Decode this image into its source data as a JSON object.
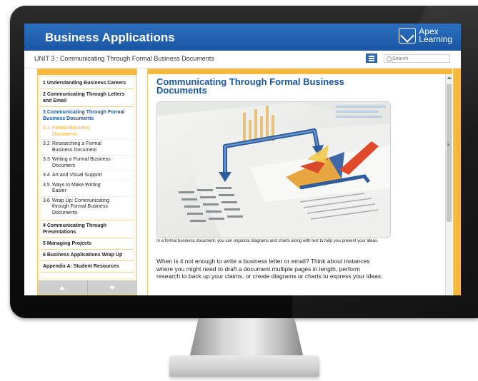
{
  "app": {
    "title": "Business Applications",
    "logo_line1": "Apex",
    "logo_line2": "Learning"
  },
  "breadcrumb": "UNIT 3 : Communicating Through Formal Business Documents",
  "search": {
    "placeholder": "Search"
  },
  "sidebar": {
    "units": [
      {
        "label": "1  Understanding Business Careers"
      },
      {
        "label": "2  Communicating Through Letters and Email"
      },
      {
        "label": "3  Communicating Through Formal Business Documents"
      }
    ],
    "lessons": [
      {
        "num": "3.1",
        "label": "Formal Business Documents"
      },
      {
        "num": "3.2",
        "label": "Researching a Formal Business Document"
      },
      {
        "num": "3.3",
        "label": "Writing a Formal Business Document"
      },
      {
        "num": "3.4",
        "label": "Art and Visual Support"
      },
      {
        "num": "3.5",
        "label": "Ways to Make Writing Easier"
      },
      {
        "num": "3.6",
        "label": "Wrap Up: Communicating through Formal Business Documents"
      }
    ],
    "units_after": [
      {
        "label": "4  Communicating Through Presentations"
      },
      {
        "label": "5  Managing Projects"
      },
      {
        "label": "6  Business Applications Wrap Up"
      },
      {
        "label": "Appendix A: Student Resources"
      }
    ]
  },
  "content": {
    "title": "Communicating Through Formal Business Documents",
    "caption": "In a formal business document, you can organize diagrams and charts along with text to help you present your ideas.",
    "body": "When is it not enough to write a business letter or email? Think about instances where you might need to draft a document multiple pages in length, perform research to back up your claims, or create diagrams or charts to express your ideas."
  },
  "colors": {
    "header_blue": "#1a56a3",
    "accent_orange": "#f7b93d",
    "active_lesson": "#f5a623"
  },
  "icons": [
    "logo-mark-icon",
    "menu-icon",
    "search-icon",
    "arrow-up-icon",
    "arrow-down-icon"
  ]
}
